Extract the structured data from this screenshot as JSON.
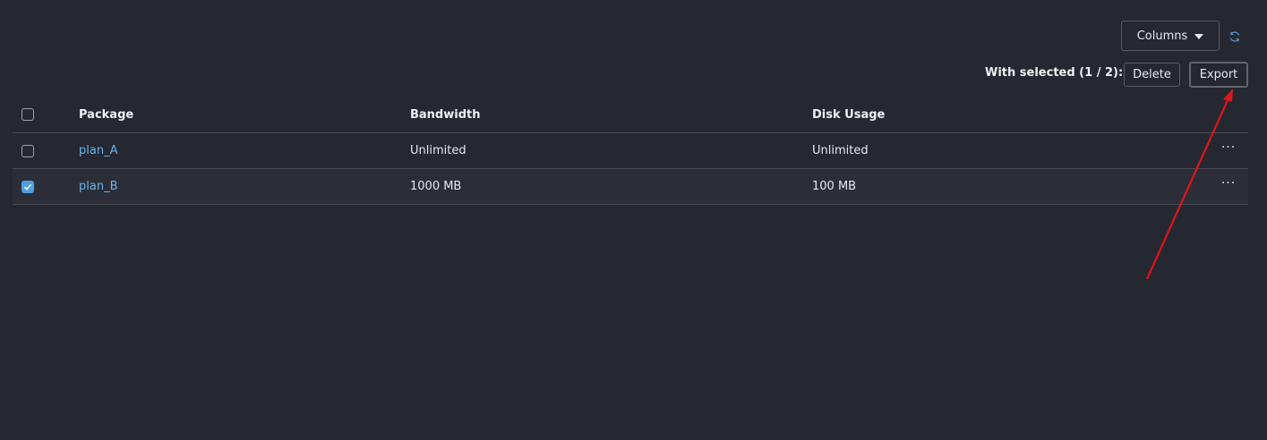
{
  "toolbar": {
    "columns_label": "Columns",
    "refresh_icon": "refresh-icon",
    "with_selected_label": "With selected (1 / 2):",
    "delete_label": "Delete",
    "export_label": "Export"
  },
  "table": {
    "headers": [
      "Package",
      "Bandwidth",
      "Disk Usage"
    ],
    "rows": [
      {
        "package": "plan_A",
        "bandwidth": "Unlimited",
        "disk_usage": "Unlimited",
        "selected": false
      },
      {
        "package": "plan_B",
        "bandwidth": "1000 MB",
        "disk_usage": "100 MB",
        "selected": true
      }
    ],
    "row_action_label": "···"
  },
  "colors": {
    "background": "#252830",
    "link": "#69b3ee",
    "checkbox_checked": "#4f9fe2",
    "annotation_arrow": "#e0141c"
  }
}
